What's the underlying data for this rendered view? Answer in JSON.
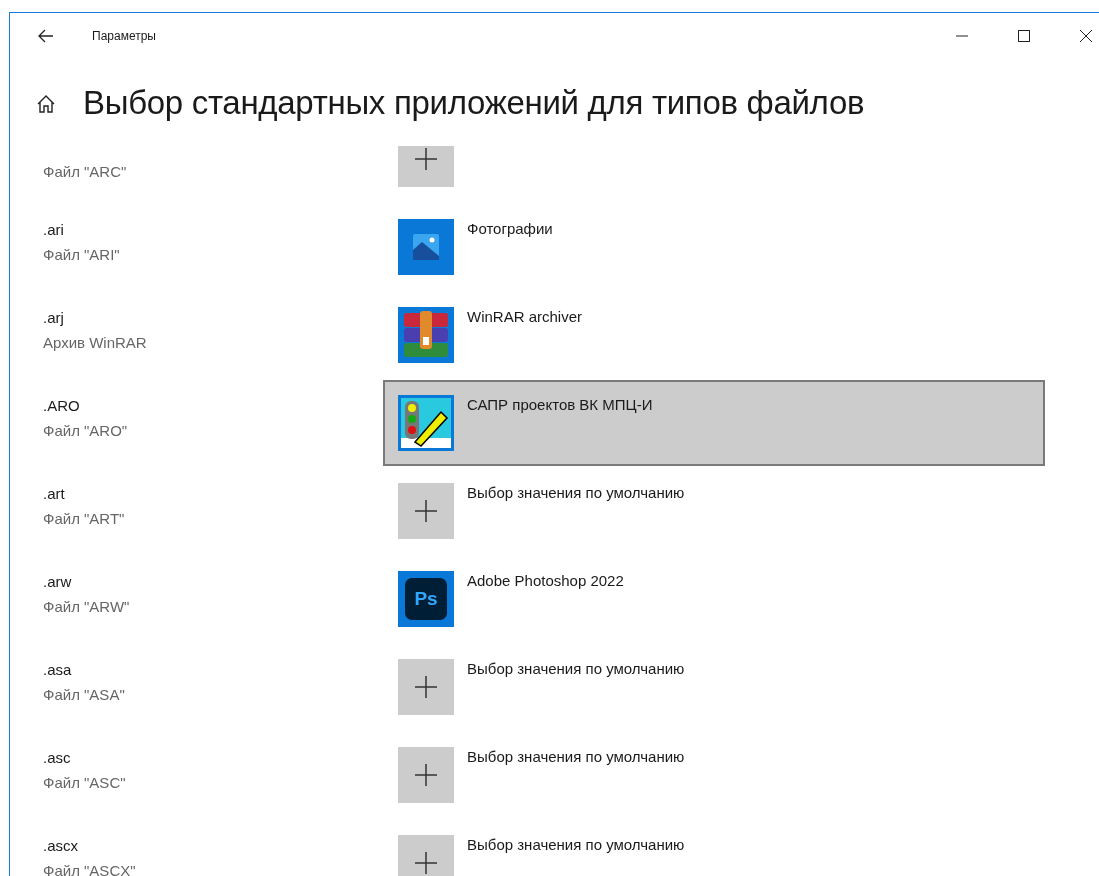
{
  "window": {
    "title": "Параметры"
  },
  "page": {
    "title": "Выбор стандартных приложений для типов файлов"
  },
  "rows": [
    {
      "description": "Файл \"ARC\"",
      "app": {
        "kind": "choose",
        "selected": false
      }
    },
    {
      "extension": ".ari",
      "description": "Файл \"ARI\"",
      "app": {
        "kind": "photos",
        "label": "Фотографии",
        "selected": false
      }
    },
    {
      "extension": ".arj",
      "description": "Архив WinRAR",
      "app": {
        "kind": "winrar",
        "label": "WinRAR archiver",
        "selected": false
      }
    },
    {
      "extension": ".ARO",
      "description": "Файл \"ARO\"",
      "app": {
        "kind": "sapr",
        "label": "САПР проектов ВК МПЦ-И",
        "selected": true
      }
    },
    {
      "extension": ".art",
      "description": "Файл \"ART\"",
      "app": {
        "kind": "choose",
        "label": "Выбор значения по умолчанию",
        "selected": false
      }
    },
    {
      "extension": ".arw",
      "description": "Файл \"ARW\"",
      "app": {
        "kind": "photoshop",
        "icon_text": "Ps",
        "label": "Adobe Photoshop 2022",
        "selected": false
      }
    },
    {
      "extension": ".asa",
      "description": "Файл \"ASA\"",
      "app": {
        "kind": "choose",
        "label": "Выбор значения по умолчанию",
        "selected": false
      }
    },
    {
      "extension": ".asc",
      "description": "Файл \"ASC\"",
      "app": {
        "kind": "choose",
        "label": "Выбор значения по умолчанию",
        "selected": false
      }
    },
    {
      "extension": ".ascx",
      "description": "Файл \"ASCX\"",
      "app": {
        "kind": "choose",
        "label": "Выбор значения по умолчанию",
        "selected": false
      }
    }
  ]
}
